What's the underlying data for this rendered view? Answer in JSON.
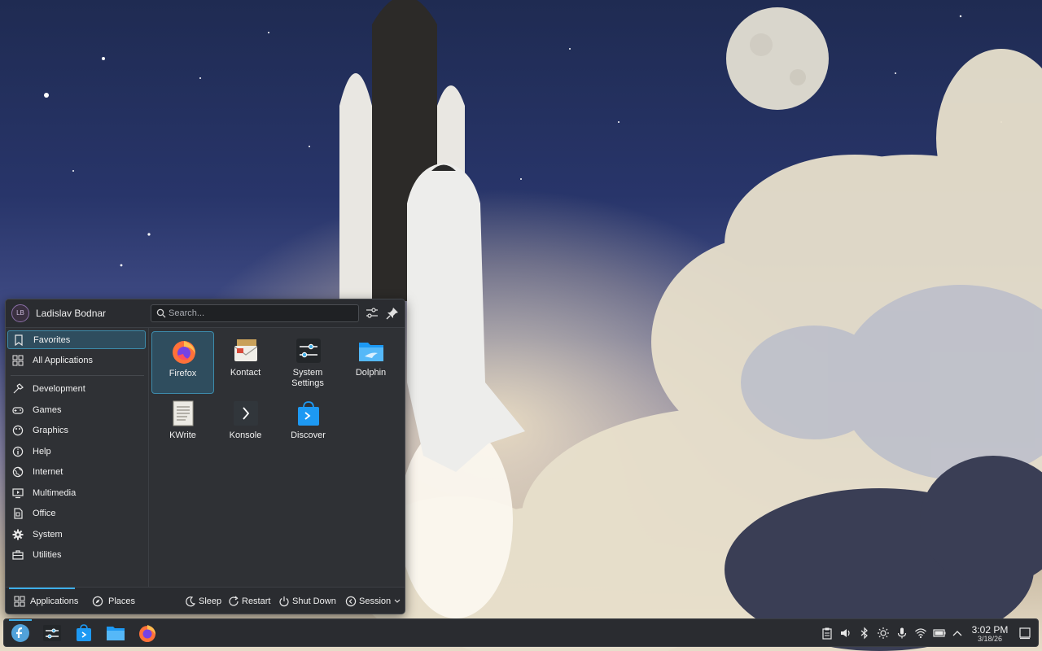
{
  "user": {
    "initials": "LB",
    "name": "Ladislav Bodnar"
  },
  "search": {
    "placeholder": "Search..."
  },
  "sidebar": {
    "top": [
      {
        "label": "Favorites",
        "icon": "bookmark-icon"
      },
      {
        "label": "All Applications",
        "icon": "grid-icon"
      }
    ],
    "categories": [
      {
        "label": "Development",
        "icon": "hammer-icon"
      },
      {
        "label": "Games",
        "icon": "gamepad-icon"
      },
      {
        "label": "Graphics",
        "icon": "palette-icon"
      },
      {
        "label": "Help",
        "icon": "info-icon"
      },
      {
        "label": "Internet",
        "icon": "globe-icon"
      },
      {
        "label": "Multimedia",
        "icon": "monitor-play-icon"
      },
      {
        "label": "Office",
        "icon": "document-icon"
      },
      {
        "label": "System",
        "icon": "gear-icon"
      },
      {
        "label": "Utilities",
        "icon": "toolbox-icon"
      }
    ]
  },
  "favorites": [
    {
      "label": "Firefox",
      "icon": "firefox-icon"
    },
    {
      "label": "Kontact",
      "icon": "kontact-icon"
    },
    {
      "label": "System Settings",
      "icon": "system-settings-icon"
    },
    {
      "label": "Dolphin",
      "icon": "folder-icon"
    },
    {
      "label": "KWrite",
      "icon": "text-editor-icon"
    },
    {
      "label": "Konsole",
      "icon": "terminal-icon"
    },
    {
      "label": "Discover",
      "icon": "shopping-bag-icon"
    }
  ],
  "footer": {
    "applications": "Applications",
    "places": "Places",
    "sleep": "Sleep",
    "restart": "Restart",
    "shutdown": "Shut Down",
    "session": "Session"
  },
  "clock": {
    "time": "3:02 PM",
    "date": "3/18/26"
  },
  "colors": {
    "accent": "#3daee9",
    "panel": "#2a2c30",
    "menu": "#2f3135"
  }
}
